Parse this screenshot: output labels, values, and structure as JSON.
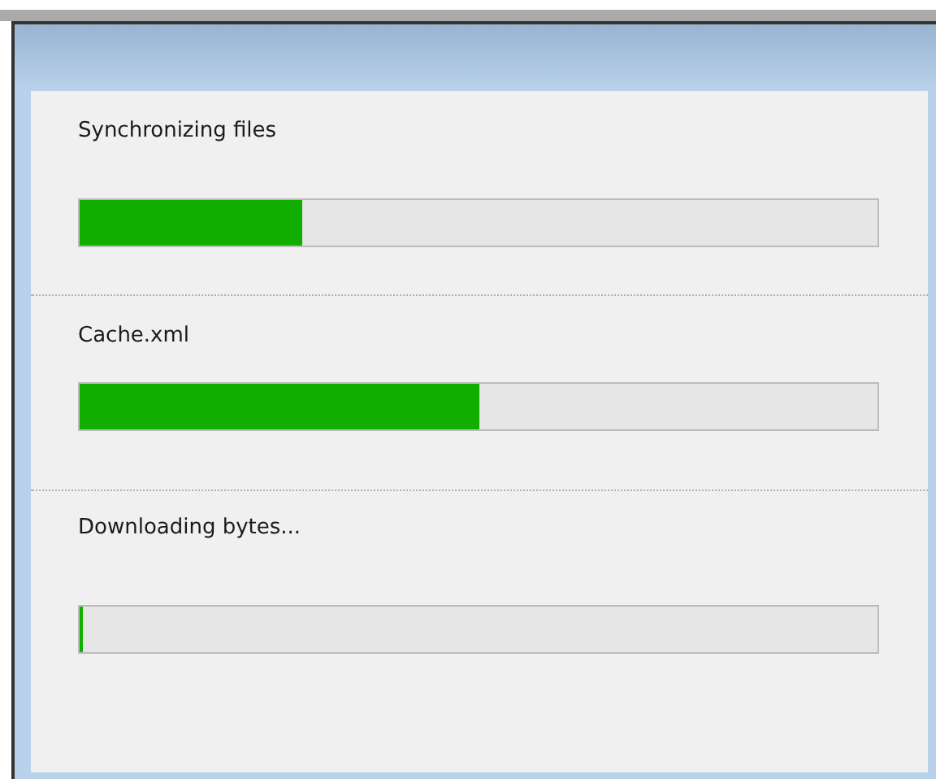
{
  "tasks": [
    {
      "label": "Synchronizing files",
      "level": 0.28
    },
    {
      "label": "Cache.xml",
      "level": 0.5
    },
    {
      "label": "Downloading bytes...",
      "level": 0.005
    }
  ]
}
